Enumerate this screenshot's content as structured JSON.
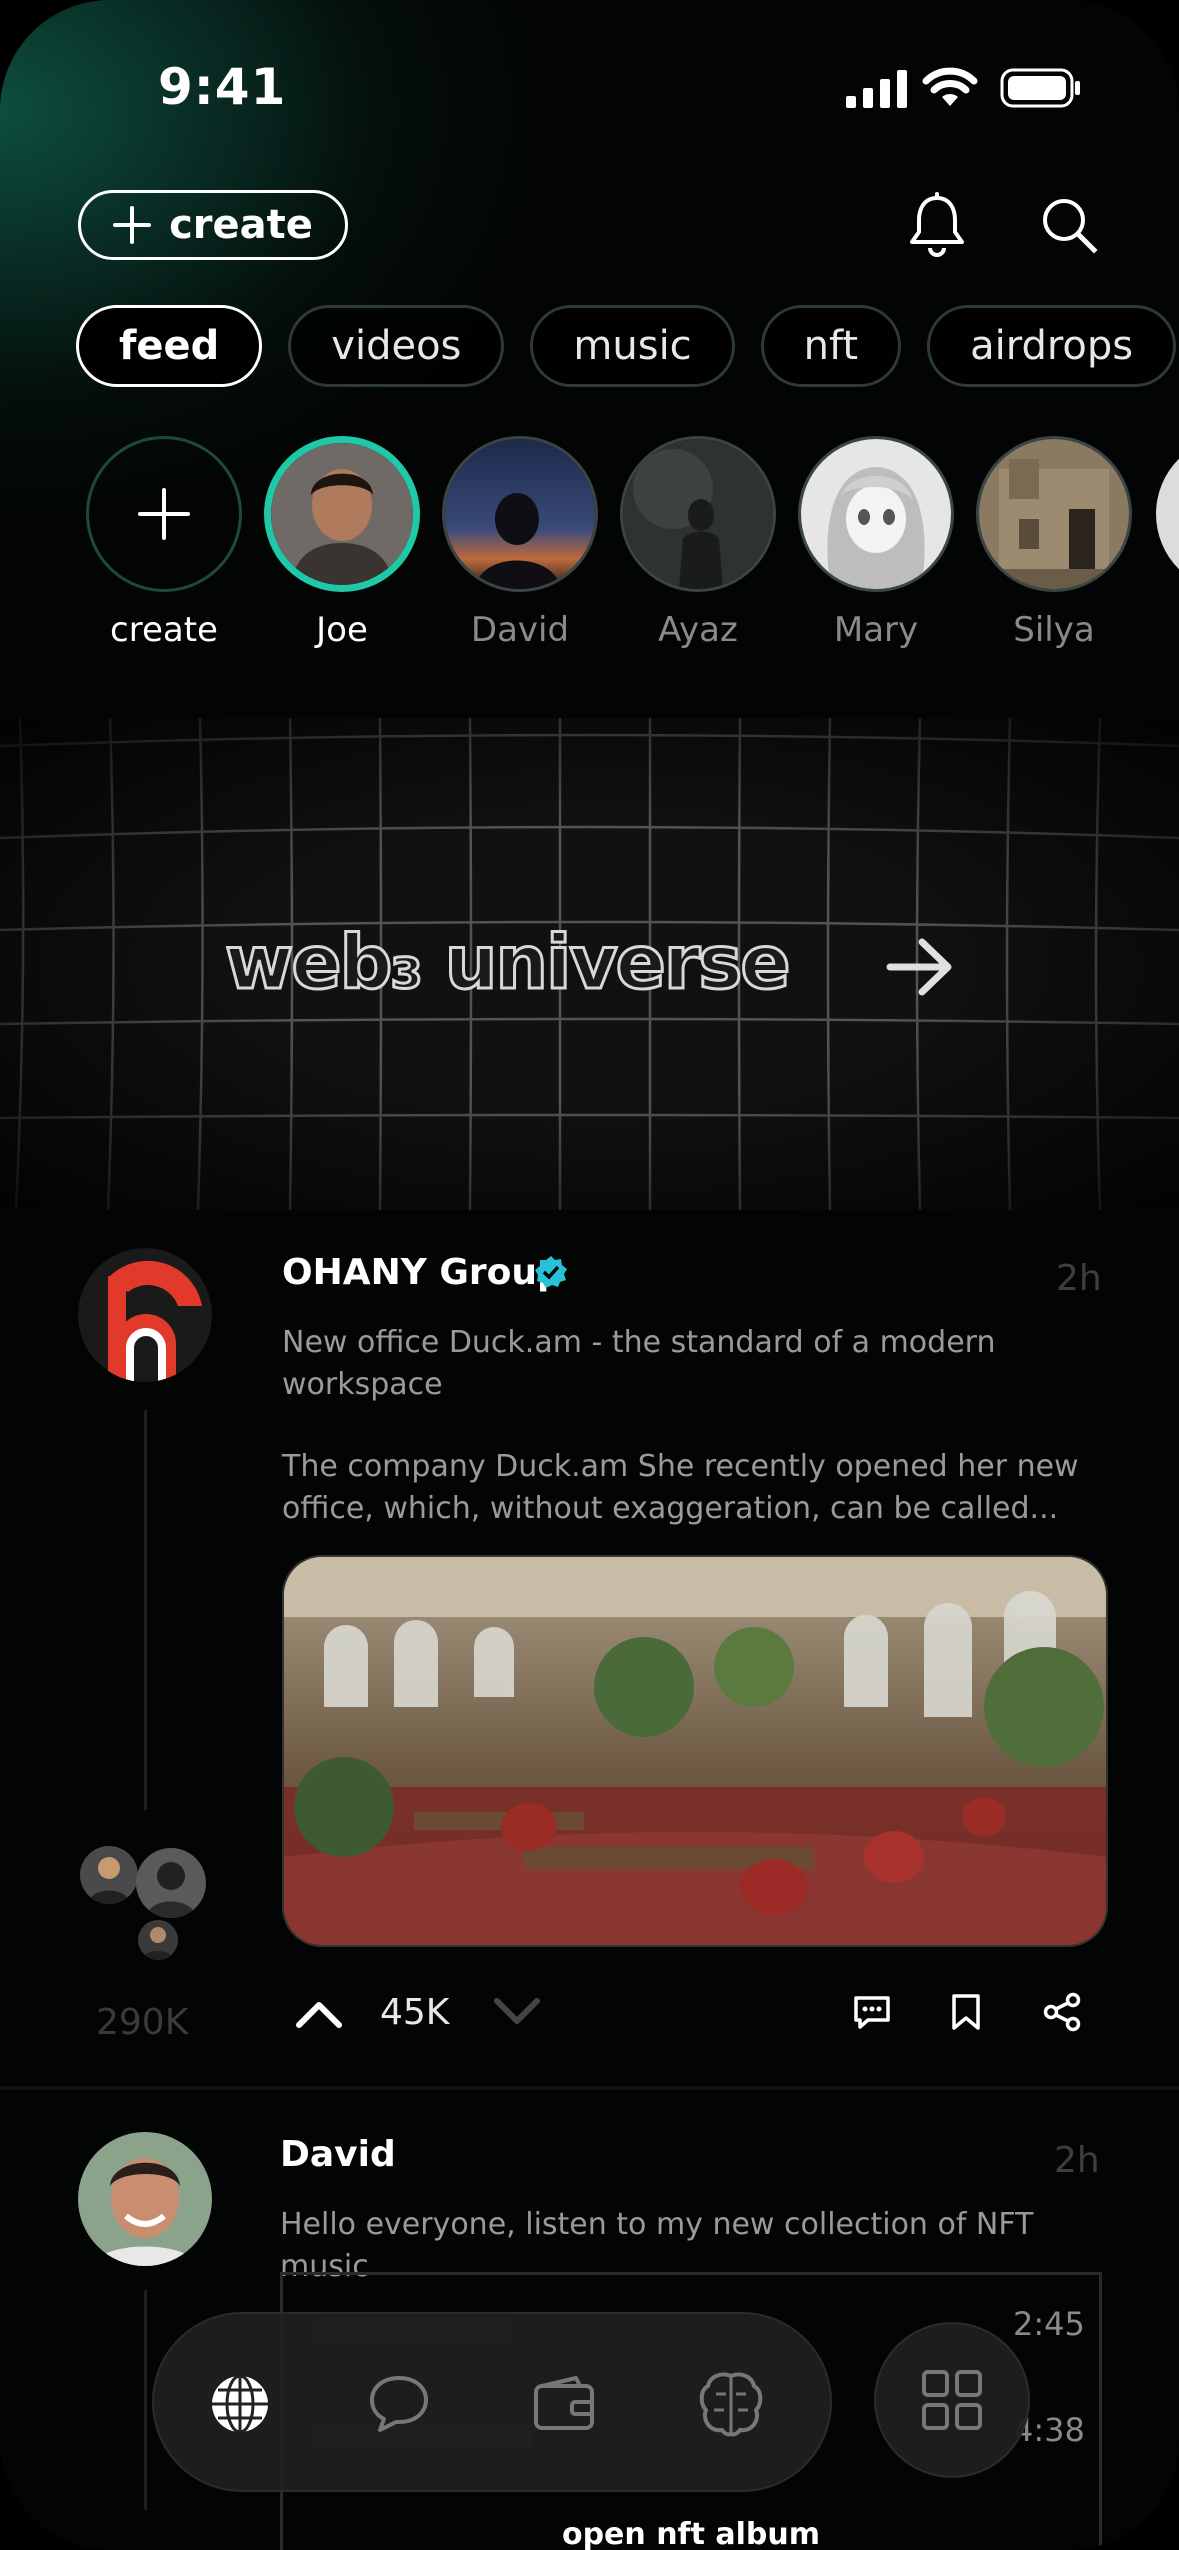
{
  "status": {
    "time": "9:41"
  },
  "header": {
    "create_label": "create"
  },
  "tabs": [
    {
      "label": "feed",
      "active": true
    },
    {
      "label": "videos",
      "active": false
    },
    {
      "label": "music",
      "active": false
    },
    {
      "label": "nft",
      "active": false
    },
    {
      "label": "airdrops",
      "active": false
    }
  ],
  "stories": [
    {
      "label": "create"
    },
    {
      "label": "Joe"
    },
    {
      "label": "David"
    },
    {
      "label": "Ayaz"
    },
    {
      "label": "Mary"
    },
    {
      "label": "Silya"
    }
  ],
  "banner": {
    "title": "web₃ universe"
  },
  "posts": [
    {
      "author": "OHANY Group",
      "verified": true,
      "time": "2h",
      "headline": "New office Duck.am - the standard of a modern workspace",
      "text": "The company Duck.am She recently opened her new office, which, without exaggeration, can be called...",
      "votes": "45K",
      "views": "290K"
    },
    {
      "author": "David",
      "time": "2h",
      "text": "Hello everyone, listen to my new collection of NFT music",
      "tracks": [
        {
          "duration": "2:45"
        },
        {
          "duration": "4:38"
        }
      ],
      "album_button": "open nft album"
    }
  ],
  "colors": {
    "accent": "#1fc8a6",
    "verified": "#29c1d6",
    "brand_red": "#e23a2a"
  },
  "icons": [
    "bell-icon",
    "search-icon",
    "plus-icon",
    "arrow-right-icon",
    "upvote-icon",
    "downvote-icon",
    "comment-icon",
    "bookmark-icon",
    "share-icon",
    "globe-icon",
    "chat-icon",
    "wallet-icon",
    "brain-icon",
    "grid-icon"
  ]
}
